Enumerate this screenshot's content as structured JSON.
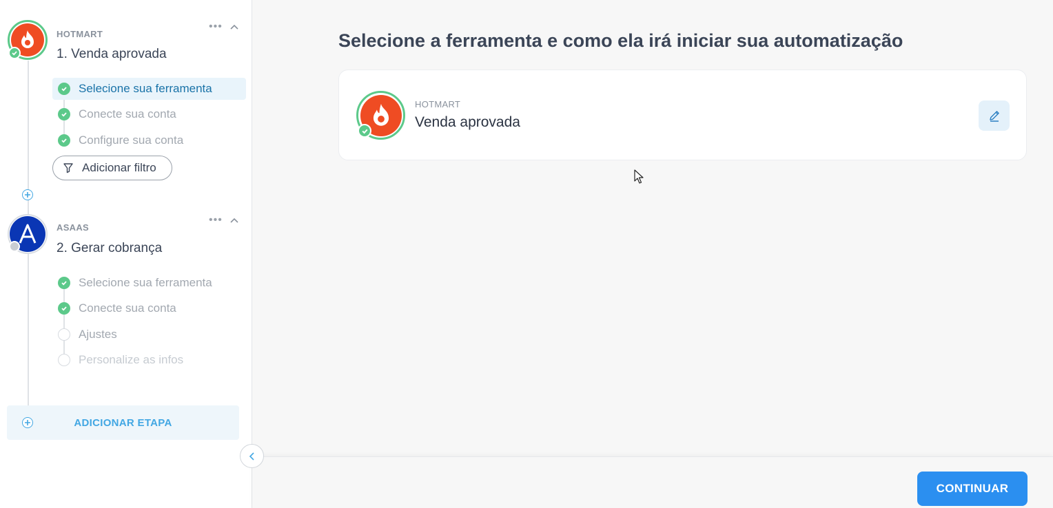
{
  "sidebar": {
    "steps": [
      {
        "app": "HOTMART",
        "title": "1. Venda aprovada",
        "logo": "hotmart-logo",
        "status": "complete",
        "substeps": [
          {
            "label": "Selecione sua ferramenta",
            "state": "active"
          },
          {
            "label": "Conecte sua conta",
            "state": "done"
          },
          {
            "label": "Configure sua conta",
            "state": "done"
          }
        ],
        "filter_label": "Adicionar filtro"
      },
      {
        "app": "ASAAS",
        "title": "2. Gerar cobrança",
        "logo": "asaas-logo",
        "status": "incomplete",
        "substeps": [
          {
            "label": "Selecione sua ferramenta",
            "state": "done"
          },
          {
            "label": "Conecte sua conta",
            "state": "done"
          },
          {
            "label": "Ajustes",
            "state": "pending"
          },
          {
            "label": "Personalize as infos",
            "state": "disabled"
          }
        ]
      }
    ],
    "more_icon": "ellipsis-icon",
    "collapse_icon": "chevron-up-icon",
    "add_step_label": "ADICIONAR ETAPA"
  },
  "main": {
    "title": "Selecione a ferramenta e como ela irá iniciar sua automatização",
    "selected": {
      "app": "HOTMART",
      "trigger": "Venda aprovada",
      "edit_icon": "pencil-icon"
    }
  },
  "footer": {
    "continue_label": "CONTINUAR"
  },
  "colors": {
    "accent": "#2b8ff0",
    "success": "#5cc98a",
    "hotmart": "#ef4c23",
    "asaas": "#0a36b4"
  }
}
